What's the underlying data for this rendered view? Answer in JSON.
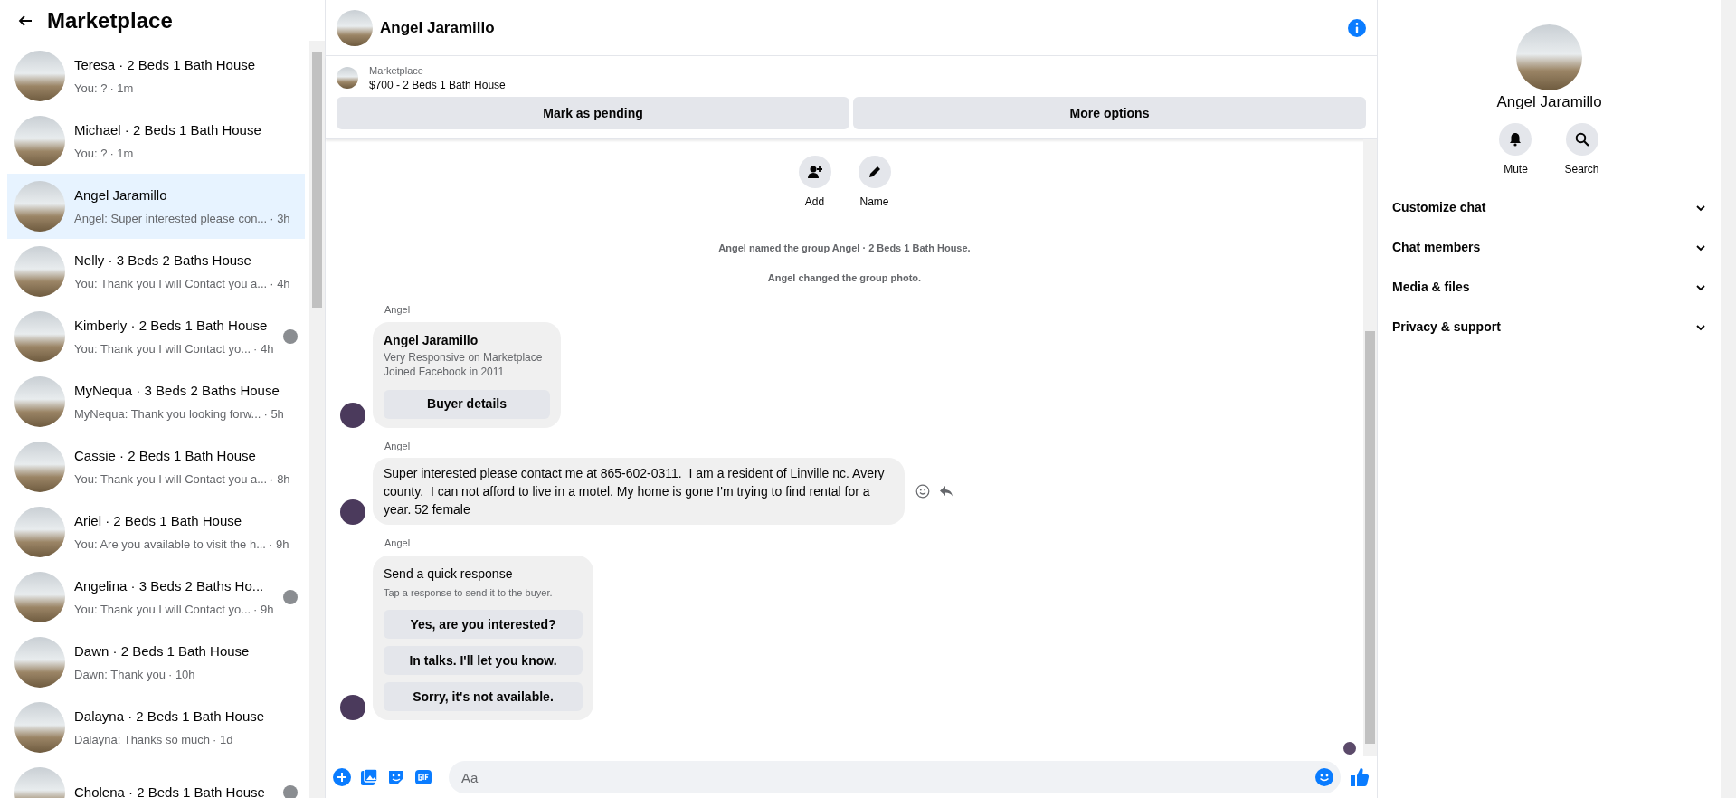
{
  "sidebar": {
    "title": "Marketplace",
    "conversations": [
      {
        "title": "Teresa · 2 Beds 1 Bath House",
        "preview": "You: ?",
        "time": "· 1m",
        "selected": false
      },
      {
        "title": "Michael · 2 Beds 1 Bath House",
        "preview": "You: ?",
        "time": "· 1m",
        "selected": false
      },
      {
        "title": "Angel Jaramillo",
        "preview": "Angel: Super interested please con...",
        "time": "· 3h",
        "selected": true
      },
      {
        "title": "Nelly · 3 Beds 2 Baths House",
        "preview": "You: Thank you I will Contact you a...",
        "time": "· 4h",
        "selected": false
      },
      {
        "title": "Kimberly · 2 Beds 1 Bath House",
        "preview": "You: Thank you I will Contact yo...",
        "time": "· 4h",
        "selected": false,
        "seen": true
      },
      {
        "title": "MyNequa · 3 Beds 2 Baths House",
        "preview": "MyNequa: Thank you looking forw...",
        "time": "· 5h",
        "selected": false
      },
      {
        "title": "Cassie · 2 Beds 1 Bath House",
        "preview": "You: Thank you I will Contact you a...",
        "time": "· 8h",
        "selected": false
      },
      {
        "title": "Ariel · 2 Beds 1 Bath House",
        "preview": "You: Are you available to visit the h...",
        "time": "· 9h",
        "selected": false
      },
      {
        "title": "Angelina · 3 Beds 2 Baths Ho...",
        "preview": "You: Thank you I will Contact yo...",
        "time": "· 9h",
        "selected": false,
        "seen": true
      },
      {
        "title": "Dawn · 2 Beds 1 Bath House",
        "preview": "Dawn: Thank you",
        "time": "· 10h",
        "selected": false
      },
      {
        "title": "Dalayna · 2 Beds 1 Bath House",
        "preview": "Dalayna: Thanks so much",
        "time": "· 1d",
        "selected": false
      },
      {
        "title": "Cholena · 2 Beds 1 Bath House",
        "selected": false,
        "seen": true
      }
    ]
  },
  "chat": {
    "title": "Angel Jaramillo",
    "listing": {
      "label": "Marketplace",
      "title": "$700 - 2 Beds 1 Bath House"
    },
    "actions": [
      "Mark as pending",
      "More options"
    ],
    "group_actions": [
      {
        "kind": "add",
        "label": "Add"
      },
      {
        "kind": "name",
        "label": "Name"
      }
    ],
    "system_messages": [
      "Angel named the group Angel · 2 Beds 1 Bath House.",
      "Angel changed the group photo."
    ],
    "messages": [
      {
        "kind": "profile_card",
        "sender": "Angel",
        "title": "Angel Jaramillo",
        "lines": [
          "Very Responsive on Marketplace",
          "Joined Facebook in 2011"
        ],
        "button": "Buyer details"
      },
      {
        "kind": "text",
        "sender": "Angel",
        "text": "Super interested please contact me at 865-602-0311.  I am a resident of Linville nc. Avery county.  I can not afford to live in a motel. My home is gone I'm trying to find rental for a year. 52 female"
      },
      {
        "kind": "quick_responses",
        "sender": "Angel",
        "title": "Send a quick response",
        "subtitle": "Tap a response to send it to the buyer.",
        "options": [
          "Yes, are you interested?",
          "In talks. I'll let you know.",
          "Sorry, it's not available."
        ]
      }
    ],
    "composer": {
      "placeholder": "Aa"
    }
  },
  "details": {
    "name": "Angel Jaramillo",
    "actions": [
      {
        "kind": "mute",
        "label": "Mute"
      },
      {
        "kind": "search",
        "label": "Search"
      }
    ],
    "sections": [
      "Customize chat",
      "Chat members",
      "Media & files",
      "Privacy & support"
    ]
  }
}
